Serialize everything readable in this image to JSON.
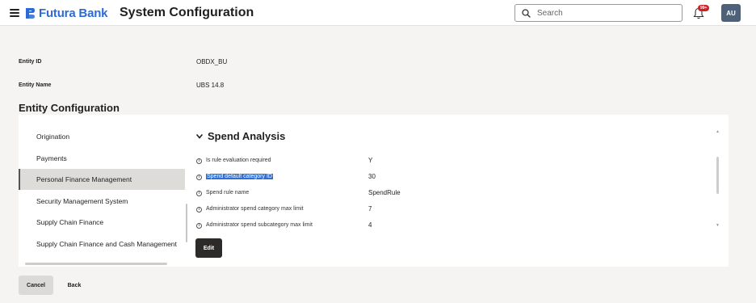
{
  "header": {
    "brand": "Futura Bank",
    "title": "System Configuration",
    "search_placeholder": "Search",
    "notification_count": "99+",
    "avatar_initials": "AU",
    "brand_color": "#2e6ad6"
  },
  "entity": {
    "id_label": "Entity ID",
    "id_value": "OBDX_BU",
    "name_label": "Entity Name",
    "name_value": "UBS 14.8"
  },
  "section_title": "Entity Configuration",
  "sidebar": {
    "items": [
      {
        "label": "Origination"
      },
      {
        "label": "Payments"
      },
      {
        "label": "Personal Finance Management",
        "active": true
      },
      {
        "label": "Security Management System"
      },
      {
        "label": "Supply Chain Finance"
      },
      {
        "label": "Supply Chain Finance and Cash Management"
      }
    ]
  },
  "detail": {
    "title": "Spend Analysis",
    "rows": [
      {
        "label": "Is rule evaluation required",
        "value": "Y"
      },
      {
        "label": "Spend default category ID",
        "value": "30",
        "highlighted": true
      },
      {
        "label": "Spend rule name",
        "value": "SpendRule"
      },
      {
        "label": "Administrator spend category max limit",
        "value": "7"
      },
      {
        "label": "Administrator spend subcategory max limit",
        "value": "4"
      }
    ],
    "edit_label": "Edit"
  },
  "footer": {
    "cancel_label": "Cancel",
    "back_label": "Back"
  },
  "icons": [
    "menu-icon",
    "futura-logo-icon",
    "search-icon",
    "bell-icon",
    "info-icon",
    "chevron-down-icon"
  ]
}
